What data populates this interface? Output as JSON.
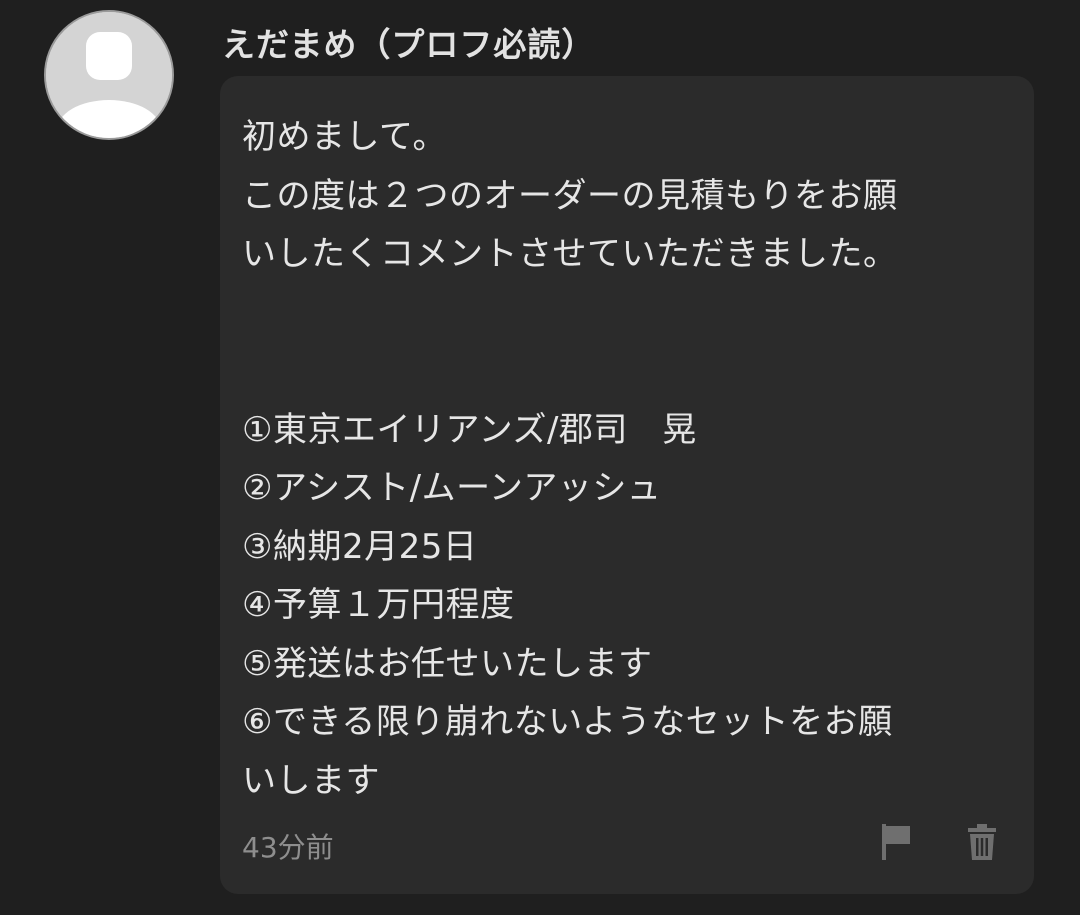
{
  "comment": {
    "author": "えだまめ（プロフ必読）",
    "lines": [
      "初めまして。",
      "この度は２つのオーダーの見積もりをお願",
      "いしたくコメントさせていただきました。",
      "",
      "",
      "①東京エイリアンズ/郡司　晃",
      "②アシスト/ムーンアッシュ",
      "③納期2月25日",
      "④予算１万円程度",
      "⑤発送はお任せいたします",
      "⑥できる限り崩れないようなセットをお願",
      "いします"
    ],
    "timestamp": "43分前",
    "icons": {
      "avatar": "default-user-avatar",
      "report": "flag-icon",
      "delete": "trash-icon"
    }
  },
  "colors": {
    "background": "#1f1f1f",
    "bubble": "#2b2b2b",
    "text": "#e6e6e6",
    "muted": "#8e8e8e",
    "icon": "#6f6f6f"
  }
}
